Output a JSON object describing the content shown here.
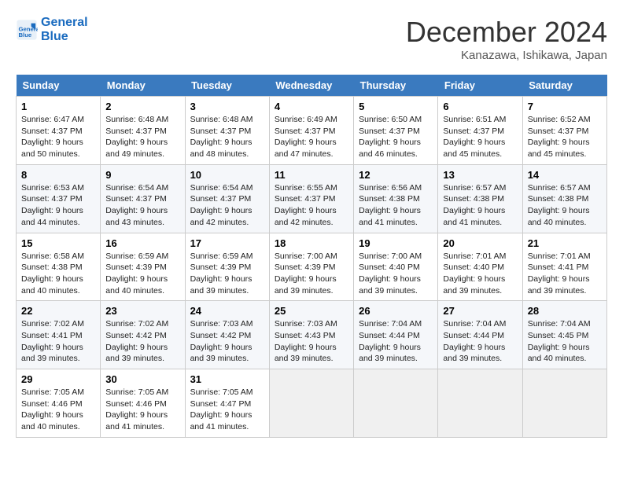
{
  "logo": {
    "line1": "General",
    "line2": "Blue"
  },
  "title": "December 2024",
  "location": "Kanazawa, Ishikawa, Japan",
  "days_header": [
    "Sunday",
    "Monday",
    "Tuesday",
    "Wednesday",
    "Thursday",
    "Friday",
    "Saturday"
  ],
  "weeks": [
    [
      {
        "day": "1",
        "sunrise": "6:47 AM",
        "sunset": "4:37 PM",
        "daylight": "9 hours and 50 minutes."
      },
      {
        "day": "2",
        "sunrise": "6:48 AM",
        "sunset": "4:37 PM",
        "daylight": "9 hours and 49 minutes."
      },
      {
        "day": "3",
        "sunrise": "6:48 AM",
        "sunset": "4:37 PM",
        "daylight": "9 hours and 48 minutes."
      },
      {
        "day": "4",
        "sunrise": "6:49 AM",
        "sunset": "4:37 PM",
        "daylight": "9 hours and 47 minutes."
      },
      {
        "day": "5",
        "sunrise": "6:50 AM",
        "sunset": "4:37 PM",
        "daylight": "9 hours and 46 minutes."
      },
      {
        "day": "6",
        "sunrise": "6:51 AM",
        "sunset": "4:37 PM",
        "daylight": "9 hours and 45 minutes."
      },
      {
        "day": "7",
        "sunrise": "6:52 AM",
        "sunset": "4:37 PM",
        "daylight": "9 hours and 45 minutes."
      }
    ],
    [
      {
        "day": "8",
        "sunrise": "6:53 AM",
        "sunset": "4:37 PM",
        "daylight": "9 hours and 44 minutes."
      },
      {
        "day": "9",
        "sunrise": "6:54 AM",
        "sunset": "4:37 PM",
        "daylight": "9 hours and 43 minutes."
      },
      {
        "day": "10",
        "sunrise": "6:54 AM",
        "sunset": "4:37 PM",
        "daylight": "9 hours and 42 minutes."
      },
      {
        "day": "11",
        "sunrise": "6:55 AM",
        "sunset": "4:37 PM",
        "daylight": "9 hours and 42 minutes."
      },
      {
        "day": "12",
        "sunrise": "6:56 AM",
        "sunset": "4:38 PM",
        "daylight": "9 hours and 41 minutes."
      },
      {
        "day": "13",
        "sunrise": "6:57 AM",
        "sunset": "4:38 PM",
        "daylight": "9 hours and 41 minutes."
      },
      {
        "day": "14",
        "sunrise": "6:57 AM",
        "sunset": "4:38 PM",
        "daylight": "9 hours and 40 minutes."
      }
    ],
    [
      {
        "day": "15",
        "sunrise": "6:58 AM",
        "sunset": "4:38 PM",
        "daylight": "9 hours and 40 minutes."
      },
      {
        "day": "16",
        "sunrise": "6:59 AM",
        "sunset": "4:39 PM",
        "daylight": "9 hours and 40 minutes."
      },
      {
        "day": "17",
        "sunrise": "6:59 AM",
        "sunset": "4:39 PM",
        "daylight": "9 hours and 39 minutes."
      },
      {
        "day": "18",
        "sunrise": "7:00 AM",
        "sunset": "4:39 PM",
        "daylight": "9 hours and 39 minutes."
      },
      {
        "day": "19",
        "sunrise": "7:00 AM",
        "sunset": "4:40 PM",
        "daylight": "9 hours and 39 minutes."
      },
      {
        "day": "20",
        "sunrise": "7:01 AM",
        "sunset": "4:40 PM",
        "daylight": "9 hours and 39 minutes."
      },
      {
        "day": "21",
        "sunrise": "7:01 AM",
        "sunset": "4:41 PM",
        "daylight": "9 hours and 39 minutes."
      }
    ],
    [
      {
        "day": "22",
        "sunrise": "7:02 AM",
        "sunset": "4:41 PM",
        "daylight": "9 hours and 39 minutes."
      },
      {
        "day": "23",
        "sunrise": "7:02 AM",
        "sunset": "4:42 PM",
        "daylight": "9 hours and 39 minutes."
      },
      {
        "day": "24",
        "sunrise": "7:03 AM",
        "sunset": "4:42 PM",
        "daylight": "9 hours and 39 minutes."
      },
      {
        "day": "25",
        "sunrise": "7:03 AM",
        "sunset": "4:43 PM",
        "daylight": "9 hours and 39 minutes."
      },
      {
        "day": "26",
        "sunrise": "7:04 AM",
        "sunset": "4:44 PM",
        "daylight": "9 hours and 39 minutes."
      },
      {
        "day": "27",
        "sunrise": "7:04 AM",
        "sunset": "4:44 PM",
        "daylight": "9 hours and 39 minutes."
      },
      {
        "day": "28",
        "sunrise": "7:04 AM",
        "sunset": "4:45 PM",
        "daylight": "9 hours and 40 minutes."
      }
    ],
    [
      {
        "day": "29",
        "sunrise": "7:05 AM",
        "sunset": "4:46 PM",
        "daylight": "9 hours and 40 minutes."
      },
      {
        "day": "30",
        "sunrise": "7:05 AM",
        "sunset": "4:46 PM",
        "daylight": "9 hours and 41 minutes."
      },
      {
        "day": "31",
        "sunrise": "7:05 AM",
        "sunset": "4:47 PM",
        "daylight": "9 hours and 41 minutes."
      },
      null,
      null,
      null,
      null
    ]
  ]
}
